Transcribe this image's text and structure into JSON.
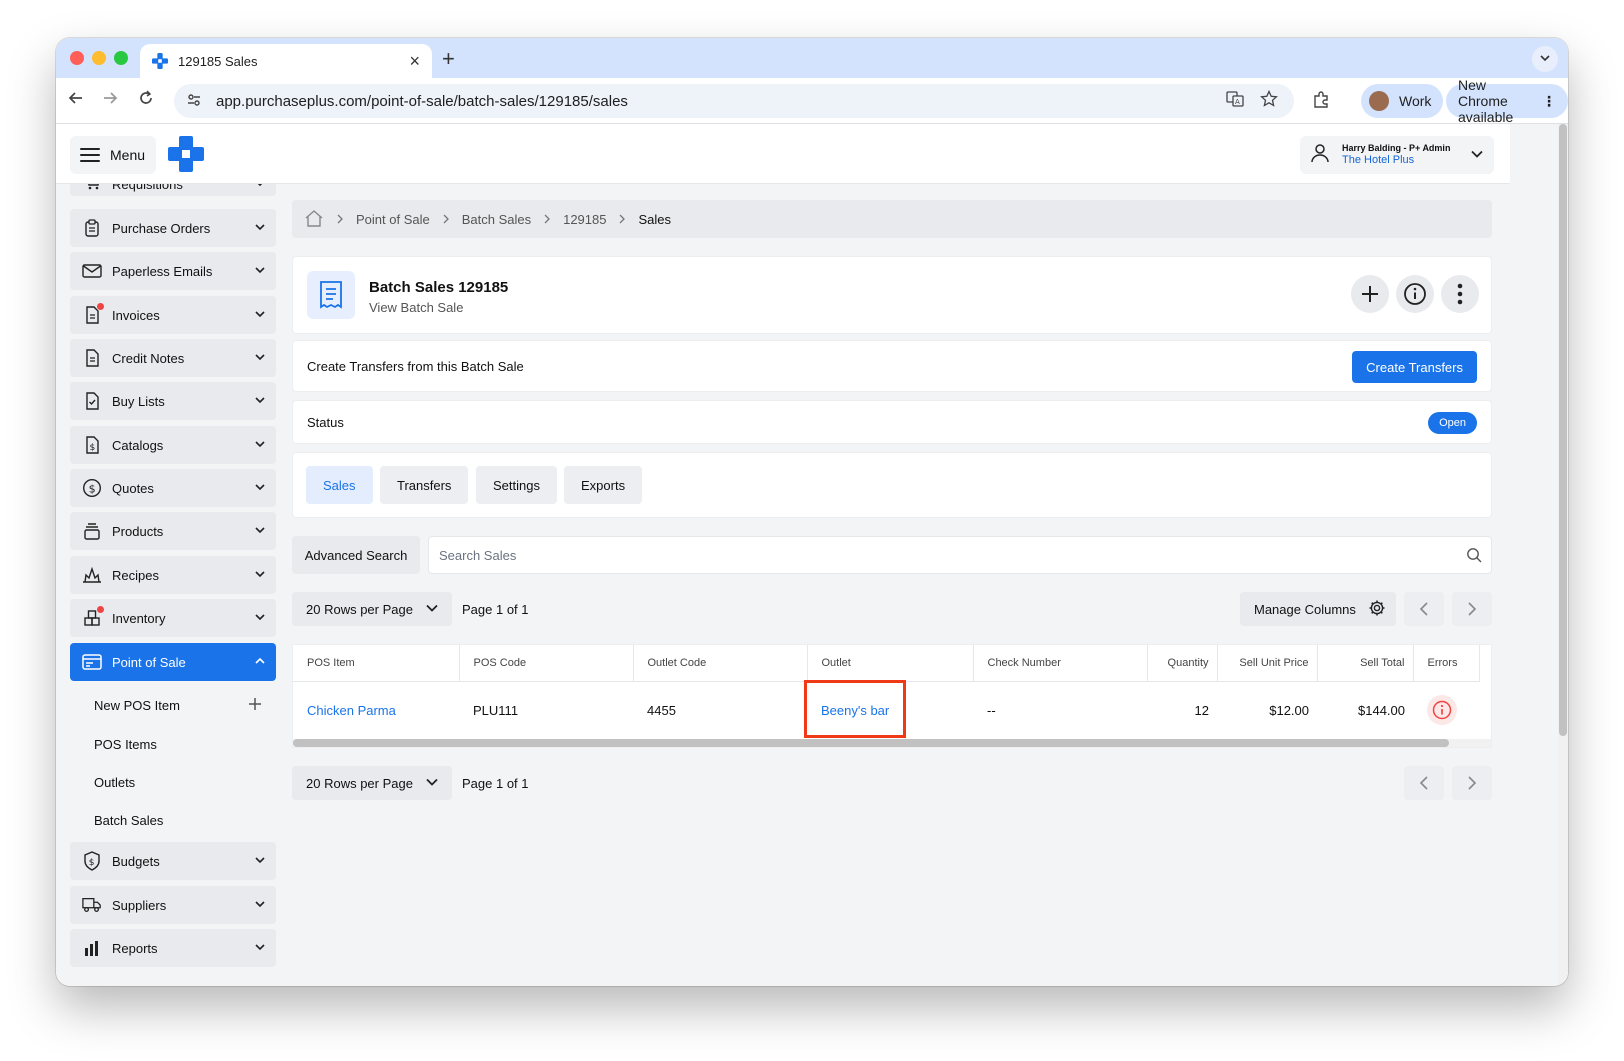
{
  "browser": {
    "tab_title": "129185 Sales",
    "tab_close": "×",
    "new_tab": "+",
    "url": "app.purchaseplus.com/point-of-sale/batch-sales/129185/sales",
    "profile": "Work",
    "update_label": "New Chrome available"
  },
  "header": {
    "menu_label": "Menu",
    "user_name": "Harry Balding - P+ Admin",
    "organisation": "The Hotel Plus"
  },
  "sidebar": {
    "items": [
      {
        "label": "Requisitions",
        "icon": "cart-icon"
      },
      {
        "label": "Purchase Orders",
        "icon": "clipboard-icon"
      },
      {
        "label": "Paperless Emails",
        "icon": "envelope-icon"
      },
      {
        "label": "Invoices",
        "icon": "invoice-icon",
        "badge": true
      },
      {
        "label": "Credit Notes",
        "icon": "document-icon"
      },
      {
        "label": "Buy Lists",
        "icon": "checklist-icon"
      },
      {
        "label": "Catalogs",
        "icon": "catalog-icon"
      },
      {
        "label": "Quotes",
        "icon": "dollar-icon"
      },
      {
        "label": "Products",
        "icon": "stack-icon"
      },
      {
        "label": "Recipes",
        "icon": "flame-icon"
      },
      {
        "label": "Inventory",
        "icon": "boxes-icon",
        "badge": true
      },
      {
        "label": "Point of Sale",
        "icon": "pos-icon",
        "active": true
      },
      {
        "label": "Budgets",
        "icon": "shield-dollar-icon"
      },
      {
        "label": "Suppliers",
        "icon": "truck-icon"
      },
      {
        "label": "Reports",
        "icon": "bar-chart-icon"
      }
    ],
    "pos_sub_items": [
      "New POS Item",
      "POS Items",
      "Outlets",
      "Batch Sales"
    ]
  },
  "breadcrumb": [
    "Point of Sale",
    "Batch Sales",
    "129185",
    "Sales"
  ],
  "page": {
    "title": "Batch Sales 129185",
    "subtitle": "View Batch Sale"
  },
  "transfers_card": {
    "label": "Create Transfers from this Batch Sale",
    "button": "Create Transfers"
  },
  "status_card": {
    "label": "Status",
    "value": "Open"
  },
  "tabs": [
    "Sales",
    "Transfers",
    "Settings",
    "Exports"
  ],
  "search": {
    "advanced_label": "Advanced Search",
    "placeholder": "Search Sales"
  },
  "pagination": {
    "rows_label": "20 Rows per Page",
    "page_label": "Page 1 of 1",
    "manage_columns": "Manage Columns"
  },
  "table": {
    "columns": [
      "POS Item",
      "POS Code",
      "Outlet Code",
      "Outlet",
      "Check Number",
      "Quantity",
      "Sell Unit Price",
      "Sell Total",
      "Errors"
    ],
    "rows": [
      {
        "pos_item": "Chicken Parma",
        "pos_code": "PLU111",
        "outlet_code": "4455",
        "outlet": "Beeny's bar",
        "check_number": "--",
        "quantity": "12",
        "sell_unit_price": "$12.00",
        "sell_total": "$144.00",
        "errors_icon": "info-icon"
      }
    ]
  },
  "colors": {
    "primary": "#1a73e8",
    "highlight": "#f03a17",
    "error": "#ef4444"
  }
}
